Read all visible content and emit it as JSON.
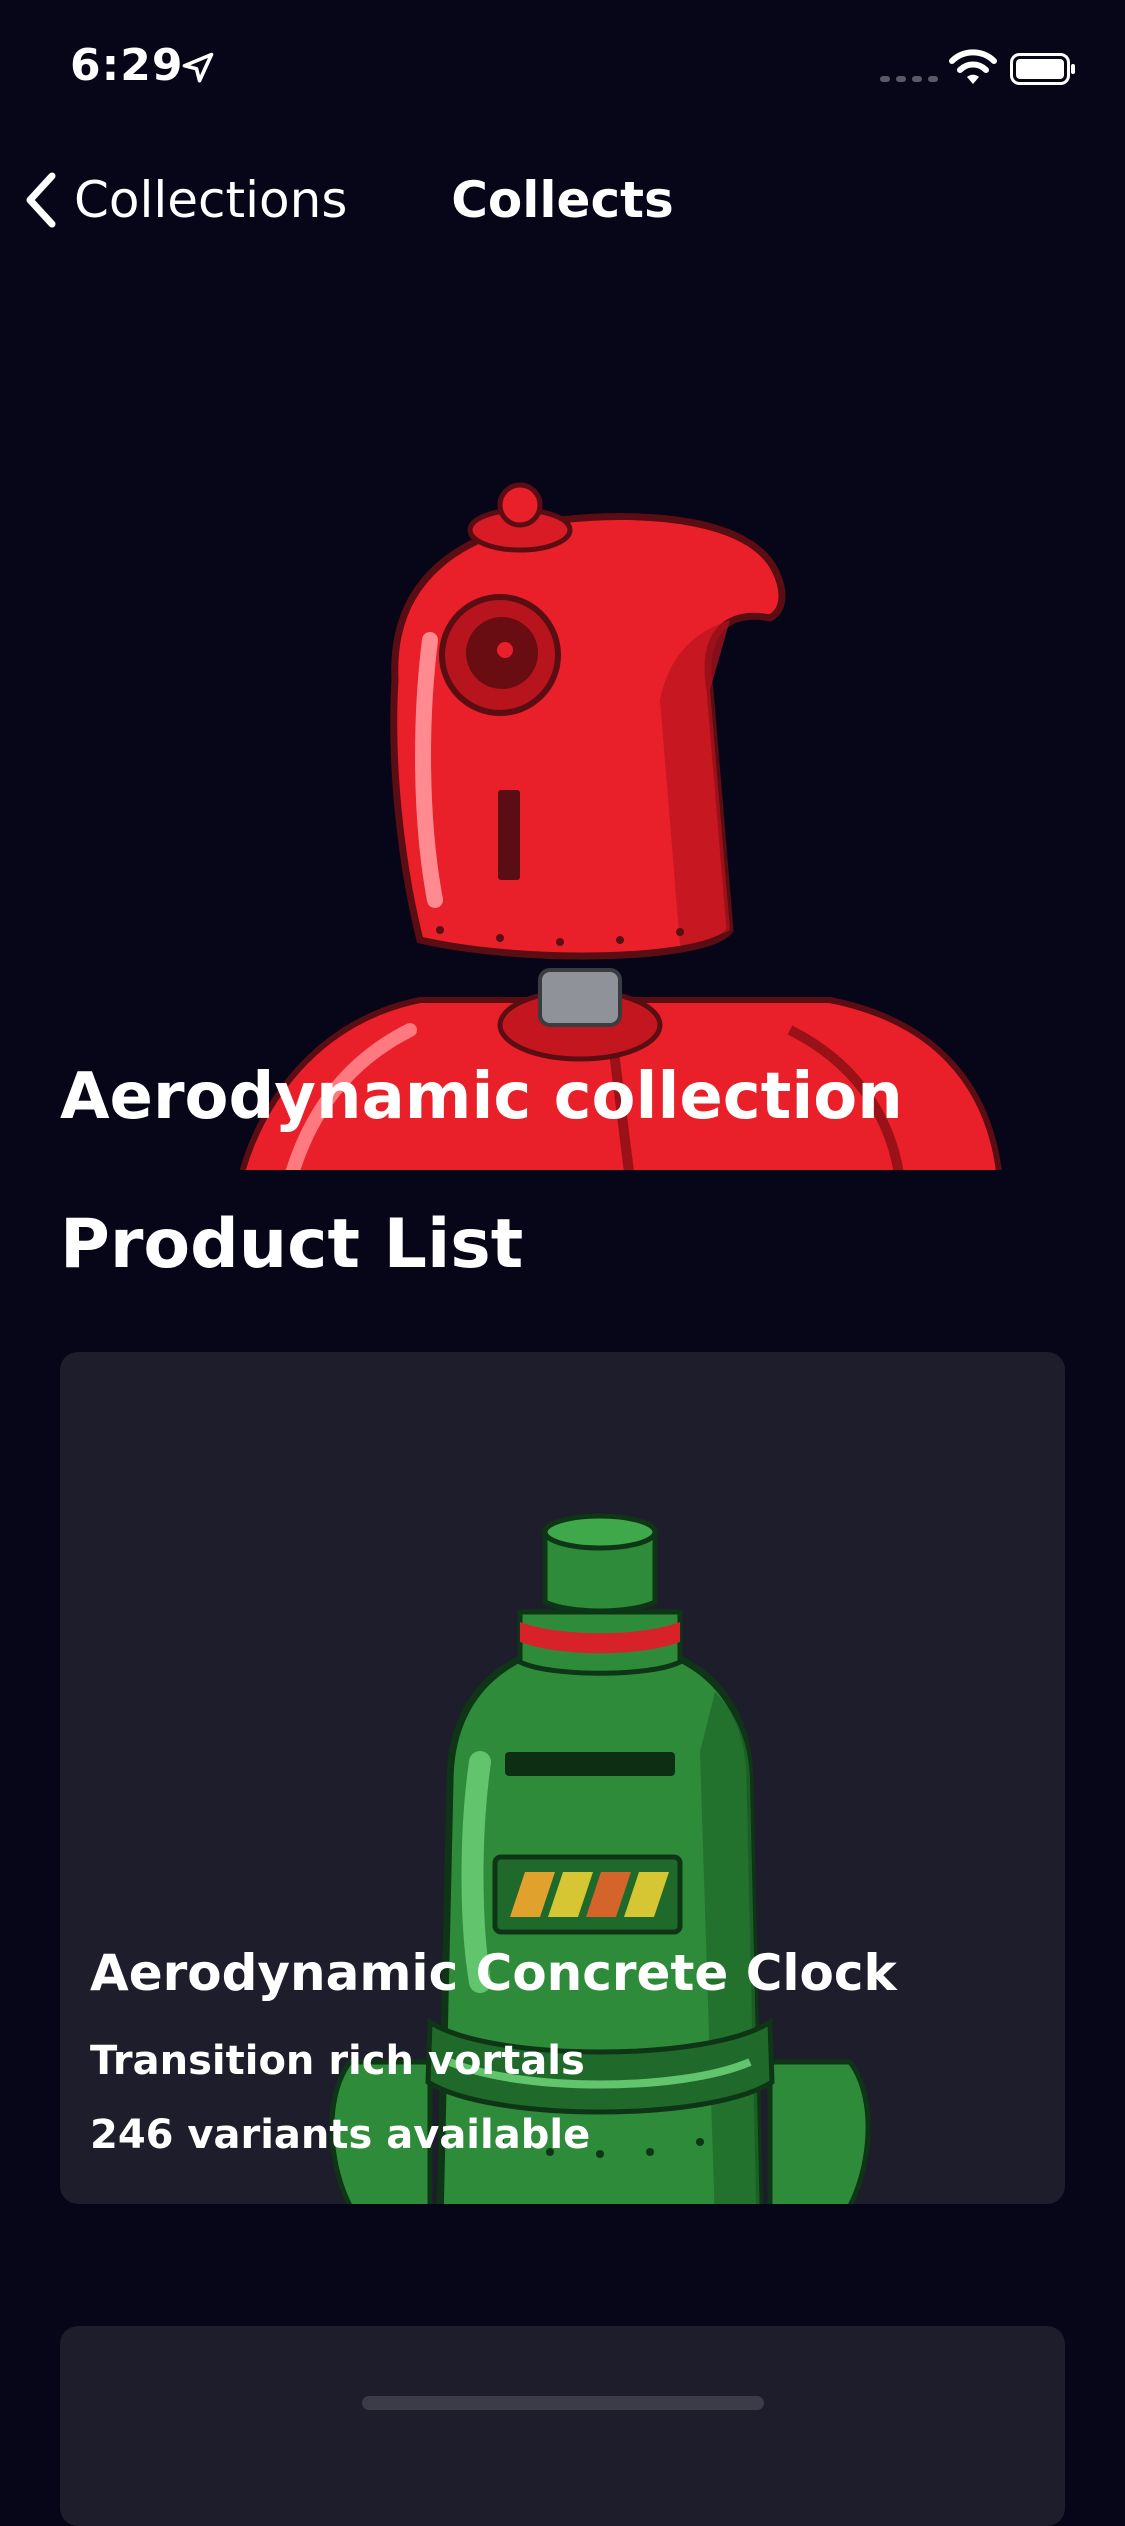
{
  "status_bar": {
    "time": "6:29"
  },
  "nav": {
    "back_label": "Collections",
    "title": "Collects"
  },
  "hero": {
    "collection_title": "Aerodynamic collection"
  },
  "section": {
    "title": "Product List"
  },
  "products": [
    {
      "name": "Aerodynamic Concrete Clock",
      "description": "Transition rich vortals",
      "variants": "246 variants available"
    }
  ],
  "colors": {
    "background": "#070619",
    "card": "#1e1d2b",
    "robot_red": "#e9202a",
    "robot_green": "#2e8b3a"
  },
  "icons": {
    "back": "chevron-left-icon",
    "location": "location-arrow-icon",
    "wifi": "wifi-icon",
    "battery": "battery-icon"
  }
}
